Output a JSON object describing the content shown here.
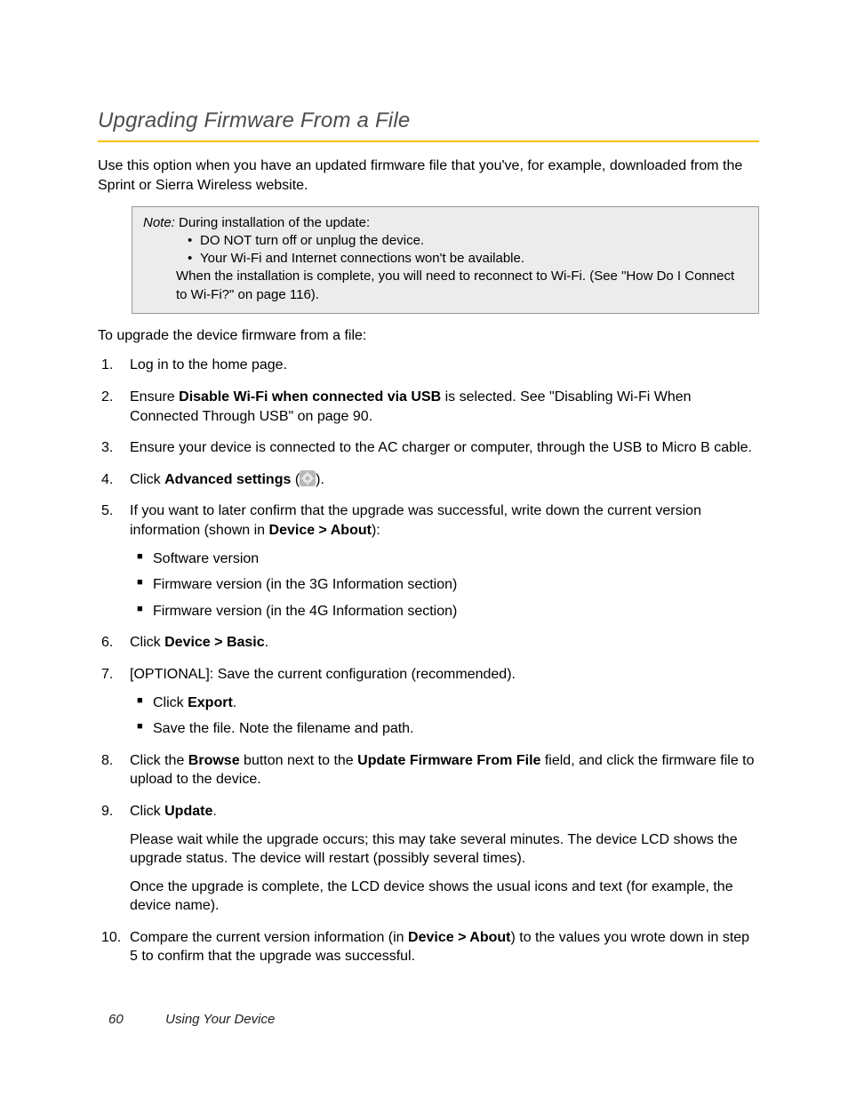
{
  "heading": "Upgrading Firmware From a File",
  "intro": "Use this option when you have an updated firmware file that you've, for example, downloaded from the Sprint or Sierra Wireless website.",
  "note": {
    "label": "Note:",
    "lead": "During installation of the update:",
    "bullets": [
      "DO NOT turn off or unplug the device.",
      "Your Wi-Fi and Internet connections won't be available."
    ],
    "after": "When the installation is complete, you will need to reconnect to Wi-Fi. (See \"How Do I Connect to Wi-Fi?\" on page 116)."
  },
  "lead_text": "To upgrade the device firmware from a file:",
  "steps": {
    "s1": "Log in to the home page.",
    "s2_a": "Ensure ",
    "s2_bold": "Disable Wi-Fi when connected via USB",
    "s2_b": " is selected. See \"Disabling Wi-Fi When Connected Through USB\" on page 90.",
    "s3": "Ensure your device is connected to the AC charger or computer, through the USB to Micro B cable.",
    "s4_a": "Click ",
    "s4_bold": "Advanced settings",
    "s4_b": " (",
    "s4_c": ").",
    "s5_a": "If you want to later confirm that the upgrade was successful, write down the current version information (shown in ",
    "s5_bold": "Device > About",
    "s5_b": "):",
    "s5_items": [
      "Software version",
      "Firmware version (in the 3G Information section)",
      "Firmware version (in the 4G Information section)"
    ],
    "s6_a": "Click ",
    "s6_bold": "Device > Basic",
    "s6_b": ".",
    "s7": "[OPTIONAL]: Save the current configuration (recommended).",
    "s7_item1_a": "Click ",
    "s7_item1_bold": "Export",
    "s7_item1_b": ".",
    "s7_item2": "Save the file. Note the filename and path.",
    "s8_a": "Click the ",
    "s8_bold1": "Browse",
    "s8_b": " button next to the ",
    "s8_bold2": "Update Firmware From File",
    "s8_c": " field, and click the firmware file to upload to the device.",
    "s9_a": "Click ",
    "s9_bold": "Update",
    "s9_b": ".",
    "s9_p1": "Please wait while the upgrade occurs; this may take several minutes. The device LCD shows the upgrade status. The device will restart (possibly several times).",
    "s9_p2": "Once the upgrade is complete, the LCD device shows the usual icons and text (for example, the device name).",
    "s10_a": "Compare the current version information (in ",
    "s10_bold": "Device > About",
    "s10_b": ") to the values you wrote down in step 5 to confirm that the upgrade was successful."
  },
  "footer": {
    "page": "60",
    "section": "Using Your Device"
  }
}
